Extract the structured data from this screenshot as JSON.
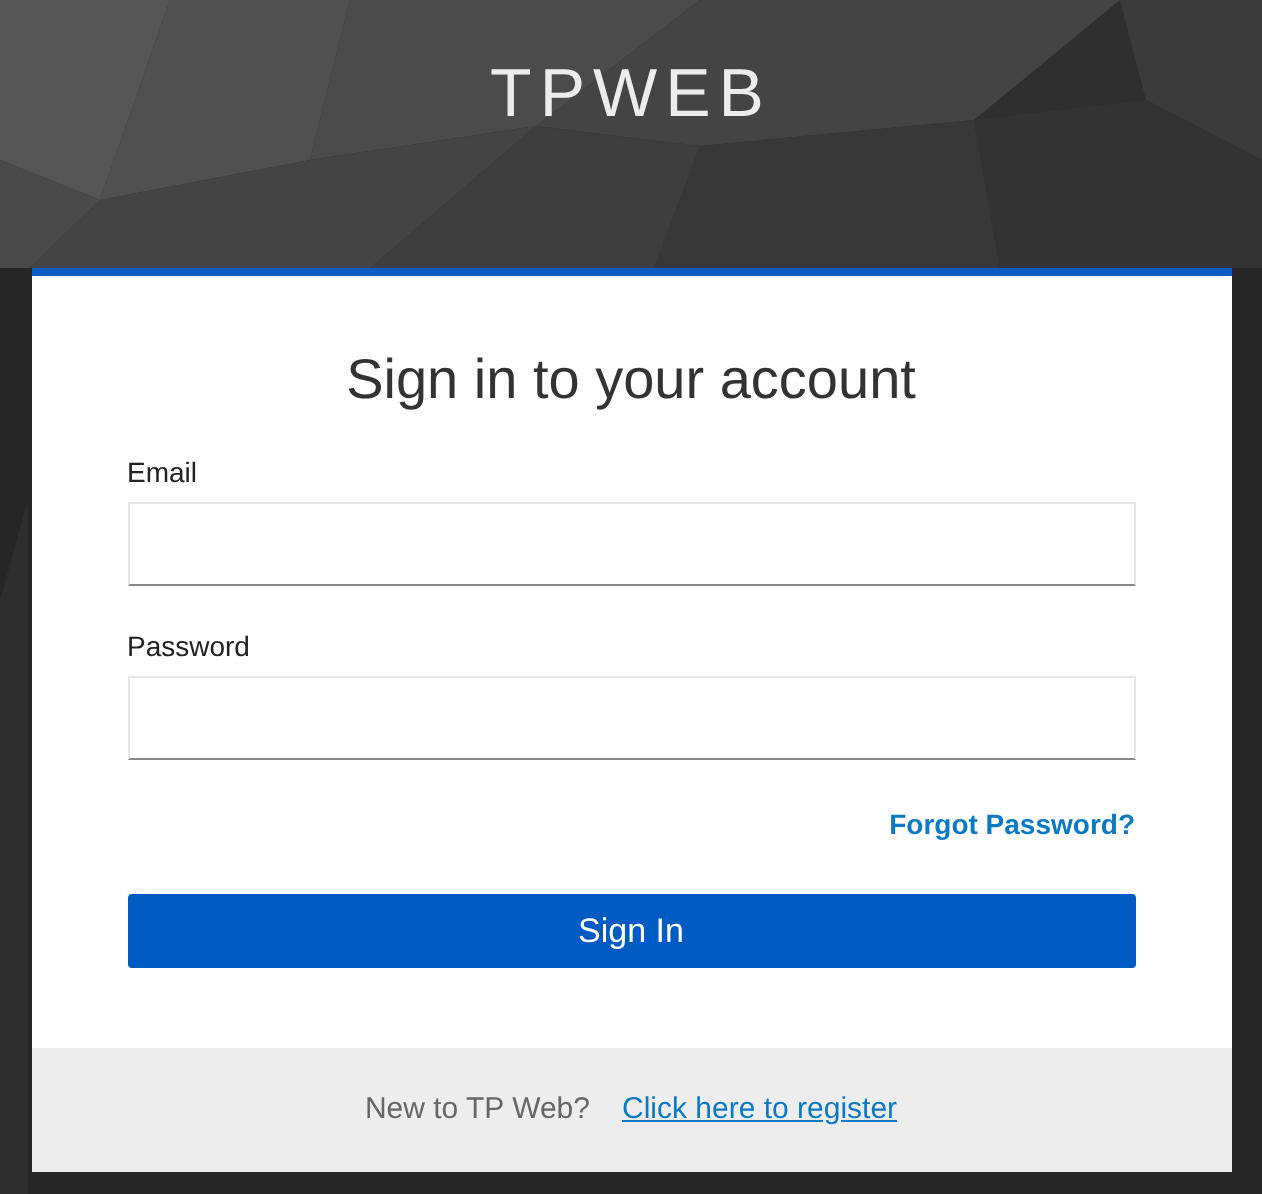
{
  "brand": "TPWEB",
  "form": {
    "title": "Sign in to your account",
    "fields": [
      {
        "label": "Email"
      },
      {
        "label": "Password"
      }
    ],
    "forgot_link": "Forgot Password?",
    "submit": "Sign In"
  },
  "footer": {
    "text": "New to TP Web?",
    "link": "Click here to register"
  }
}
